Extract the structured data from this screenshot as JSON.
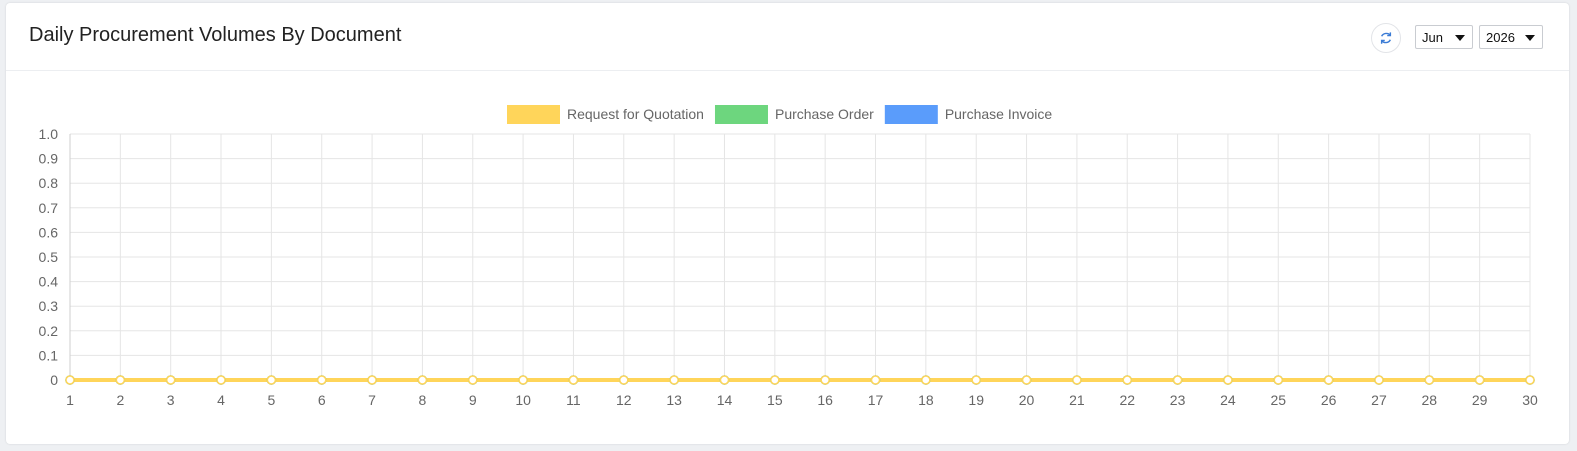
{
  "header": {
    "title": "Daily Procurement Volumes By Document",
    "month_selected": "Jun",
    "year_selected": "2026"
  },
  "refresh_icon": "refresh-icon",
  "chart_data": {
    "type": "line",
    "x": [
      1,
      2,
      3,
      4,
      5,
      6,
      7,
      8,
      9,
      10,
      11,
      12,
      13,
      14,
      15,
      16,
      17,
      18,
      19,
      20,
      21,
      22,
      23,
      24,
      25,
      26,
      27,
      28,
      29,
      30
    ],
    "ylim": [
      0,
      1
    ],
    "yticks": [
      "0",
      "0.1",
      "0.2",
      "0.3",
      "0.4",
      "0.5",
      "0.6",
      "0.7",
      "0.8",
      "0.9",
      "1.0"
    ],
    "grid": true,
    "legend_position": "top-center",
    "series": [
      {
        "name": "Request for Quotation",
        "color": "#ffd55a",
        "values": [
          0,
          0,
          0,
          0,
          0,
          0,
          0,
          0,
          0,
          0,
          0,
          0,
          0,
          0,
          0,
          0,
          0,
          0,
          0,
          0,
          0,
          0,
          0,
          0,
          0,
          0,
          0,
          0,
          0,
          0
        ]
      },
      {
        "name": "Purchase Order",
        "color": "#6dd67e",
        "values": [
          0,
          0,
          0,
          0,
          0,
          0,
          0,
          0,
          0,
          0,
          0,
          0,
          0,
          0,
          0,
          0,
          0,
          0,
          0,
          0,
          0,
          0,
          0,
          0,
          0,
          0,
          0,
          0,
          0,
          0
        ]
      },
      {
        "name": "Purchase Invoice",
        "color": "#5a9cfb",
        "values": [
          0,
          0,
          0,
          0,
          0,
          0,
          0,
          0,
          0,
          0,
          0,
          0,
          0,
          0,
          0,
          0,
          0,
          0,
          0,
          0,
          0,
          0,
          0,
          0,
          0,
          0,
          0,
          0,
          0,
          0
        ]
      }
    ]
  }
}
